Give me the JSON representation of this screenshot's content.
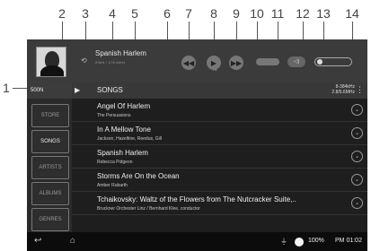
{
  "callouts": [
    "1",
    "2",
    "3",
    "4",
    "5",
    "6",
    "7",
    "8",
    "9",
    "10",
    "11",
    "12",
    "13",
    "14"
  ],
  "player": {
    "track_title": "Spanish Harlem",
    "track_meta": "24bit / 176.4kHz",
    "prev_icon": "rewind-icon",
    "play_icon": "play-icon",
    "next_icon": "fast-forward-icon"
  },
  "sidebar": {
    "storage": "500N",
    "items": [
      {
        "label": "STORE"
      },
      {
        "label": "SONGS",
        "active": true
      },
      {
        "label": "ARTISTS"
      },
      {
        "label": "ALBUMS"
      },
      {
        "label": "GENRES"
      }
    ]
  },
  "list": {
    "title": "SONGS",
    "filter_line1": "8-384kHz",
    "filter_line2": "2.8/5.6MHz",
    "songs": [
      {
        "title": "Angel Of Harlem",
        "artist": "The Persuasions"
      },
      {
        "title": "In A Mellow Tone",
        "artist": "Jackson, Hazeltine, Reedus, Gill"
      },
      {
        "title": "Spanish Harlem",
        "artist": "Rebecca Pidgeon"
      },
      {
        "title": "Storms Are On the Ocean",
        "artist": "Amber Rubarth"
      },
      {
        "title": "Tchaikovsky: Waltz of the Flowers from The Nutcracker Suite,..",
        "artist": "Bruckner Orchester Linz / Bernhard Klee, conductor"
      }
    ]
  },
  "status": {
    "battery": "100%",
    "time": "PM 01:02"
  }
}
